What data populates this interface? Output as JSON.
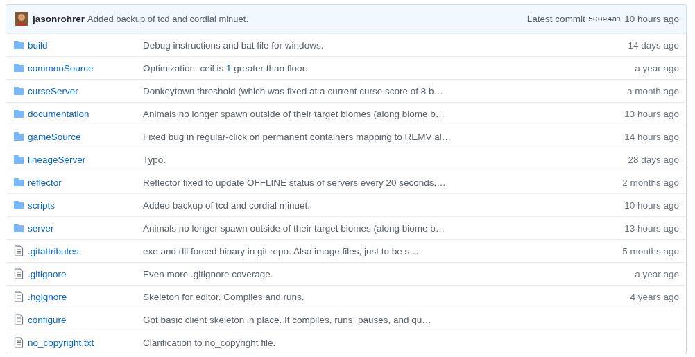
{
  "latest_commit": {
    "author": "jasonrohrer",
    "message": "Added backup of tcd and cordial minuet.",
    "label": "Latest commit",
    "sha": "50094a1",
    "age": "10 hours ago"
  },
  "files": [
    {
      "kind": "folder",
      "name": "build",
      "message": [
        {
          "kind": "text",
          "text": "Debug instructions and bat file for windows."
        }
      ],
      "age": "14 days ago"
    },
    {
      "kind": "folder",
      "name": "commonSource",
      "message": [
        {
          "kind": "text",
          "text": "Optimization: ceil is "
        },
        {
          "kind": "link",
          "text": "1"
        },
        {
          "kind": "text",
          "text": " greater than floor."
        }
      ],
      "age": "a year ago"
    },
    {
      "kind": "folder",
      "name": "curseServer",
      "message": [
        {
          "kind": "text",
          "text": "Donkeytown threshold (which was fixed at a current curse score of 8 b…"
        }
      ],
      "age": "a month ago"
    },
    {
      "kind": "folder",
      "name": "documentation",
      "message": [
        {
          "kind": "text",
          "text": "Animals no longer spawn outside of their target biomes (along biome b…"
        }
      ],
      "age": "13 hours ago"
    },
    {
      "kind": "folder",
      "name": "gameSource",
      "message": [
        {
          "kind": "text",
          "text": "Fixed bug in regular-click on permanent containers mapping to REMV al…"
        }
      ],
      "age": "14 hours ago"
    },
    {
      "kind": "folder",
      "name": "lineageServer",
      "message": [
        {
          "kind": "text",
          "text": "Typo."
        }
      ],
      "age": "28 days ago"
    },
    {
      "kind": "folder",
      "name": "reflector",
      "message": [
        {
          "kind": "text",
          "text": "Reflector fixed to update OFFLINE status of servers every 20 seconds,…"
        }
      ],
      "age": "2 months ago"
    },
    {
      "kind": "folder",
      "name": "scripts",
      "message": [
        {
          "kind": "text",
          "text": "Added backup of tcd and cordial minuet."
        }
      ],
      "age": "10 hours ago"
    },
    {
      "kind": "folder",
      "name": "server",
      "message": [
        {
          "kind": "text",
          "text": "Animals no longer spawn outside of their target biomes (along biome b…"
        }
      ],
      "age": "13 hours ago"
    },
    {
      "kind": "file",
      "name": ".gitattributes",
      "message": [
        {
          "kind": "text",
          "text": "exe and dll forced binary in git repo. Also image files, just to be s…"
        }
      ],
      "age": "5 months ago"
    },
    {
      "kind": "file",
      "name": ".gitignore",
      "message": [
        {
          "kind": "text",
          "text": "Even more .gitignore coverage."
        }
      ],
      "age": "a year ago"
    },
    {
      "kind": "file",
      "name": ".hgignore",
      "message": [
        {
          "kind": "text",
          "text": "Skeleton for editor. Compiles and runs."
        }
      ],
      "age": "4 years ago"
    },
    {
      "kind": "file",
      "name": "configure",
      "message": [
        {
          "kind": "text",
          "text": "Got basic client skeleton in place. It compiles, runs, pauses, and qu…"
        }
      ]
    },
    {
      "kind": "file",
      "name": "no_copyright.txt",
      "message": [
        {
          "kind": "text",
          "text": "Clarification to no_copyright file."
        }
      ]
    }
  ]
}
